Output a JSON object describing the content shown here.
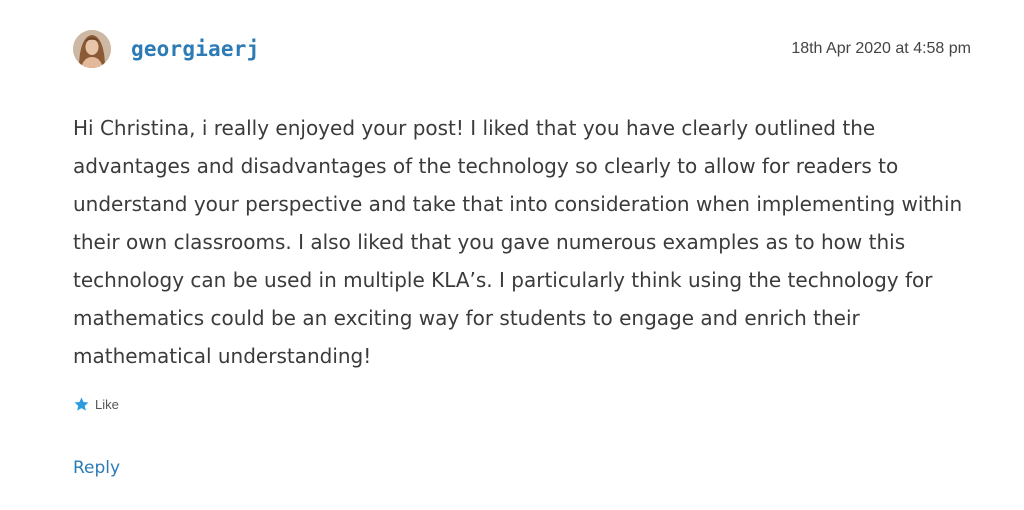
{
  "comment": {
    "author": "georgiaerj",
    "timestamp": "18th Apr 2020 at 4:58 pm",
    "text": "Hi Christina, i really enjoyed your post! I liked that you have clearly outlined the advantages and disadvantages of the technology so clearly to allow for readers to understand your perspective and take that into consideration when implementing within their own classrooms. I also liked that you gave numerous examples as to how this technology can be used in multiple KLA’s. I particularly think using the technology for mathematics could be an exciting way for students to engage and enrich their mathematical understanding!",
    "like_label": "Like",
    "like_icon": "star-icon",
    "reply_label": "Reply"
  },
  "colors": {
    "link": "#2d7bb6",
    "star": "#2d9be0",
    "text": "#3b3b3b"
  }
}
